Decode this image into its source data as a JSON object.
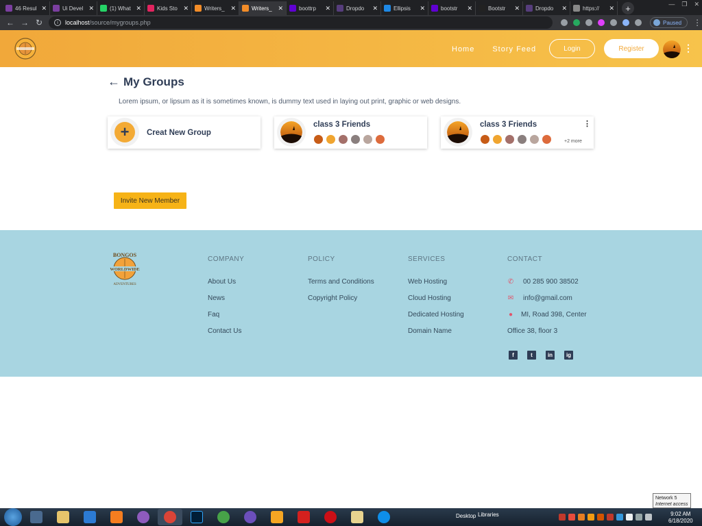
{
  "browser": {
    "tabs": [
      {
        "title": "46 Resul",
        "color": "#7b3fa0"
      },
      {
        "title": "Ui Devel",
        "color": "#7b3fa0"
      },
      {
        "title": "(1) What",
        "color": "#25d366"
      },
      {
        "title": "Kids Sto",
        "color": "#e2245f"
      },
      {
        "title": "Writers_",
        "color": "#f28c28"
      },
      {
        "title": "Writers_",
        "color": "#f28c28",
        "active": true
      },
      {
        "title": "boottrp",
        "color": "#6001d2"
      },
      {
        "title": "Dropdo",
        "color": "#563d7c"
      },
      {
        "title": "Ellipsis",
        "color": "#1e88e5"
      },
      {
        "title": "bootstr",
        "color": "#6001d2"
      },
      {
        "title": "Bootstr",
        "color": "#222"
      },
      {
        "title": "Dropdo",
        "color": "#563d7c"
      },
      {
        "title": "https://",
        "color": "#888"
      }
    ],
    "url_host": "localhost",
    "url_path": "/source/mygroups.php",
    "paused_label": "Paused"
  },
  "header": {
    "nav": [
      "Home",
      "Story Feed"
    ],
    "login_label": "Login",
    "register_label": "Register",
    "kebab": "⋮"
  },
  "main": {
    "back_icon": "←",
    "title": "My Groups",
    "description": "Lorem ipsum, or lipsum as it is sometimes known, is dummy text used in laying out print, graphic or web designs.",
    "create_card": {
      "plus": "+",
      "label": "Creat New Group"
    },
    "groups": [
      {
        "name": "class 3 Friends",
        "more": ""
      },
      {
        "name": "class 3 Friends",
        "more": "+2 more",
        "kebab": "⋮"
      }
    ],
    "member_colors": [
      "#c75c17",
      "#f0a530",
      "#a4706a",
      "#8a7f7e",
      "#b9a69e",
      "#dd6b3c"
    ],
    "invite_label": "Invite New Member"
  },
  "footer": {
    "company": {
      "heading": "COMPANY",
      "links": [
        "About Us",
        "News",
        "Faq",
        "Contact Us"
      ]
    },
    "policy": {
      "heading": "POLICY",
      "links": [
        "Terms and Conditions",
        "Copyright Policy"
      ]
    },
    "services": {
      "heading": "SERVICES",
      "links": [
        "Web Hosting",
        "Cloud Hosting",
        "Dedicated Hosting",
        "Domain Name"
      ]
    },
    "contact": {
      "heading": "CONTACT",
      "phone": "00 285 900 38502",
      "email": "info@gmail.com",
      "address1": "MI, Road 398, Center",
      "address2": "Office 38, floor 3"
    },
    "socials": [
      "f",
      "t",
      "in",
      "ig"
    ]
  },
  "taskbar": {
    "desktop_label": "Desktop",
    "libraries_label": "Libraries",
    "time": "9:02 AM",
    "date": "6/18/2020",
    "network_popup_line1": "Network 5",
    "network_popup_line2": "Internet access"
  }
}
